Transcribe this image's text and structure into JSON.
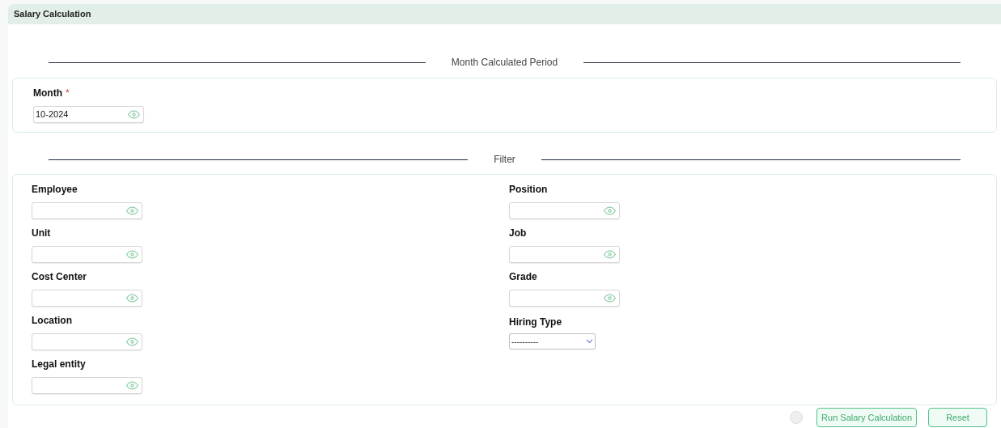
{
  "header": {
    "title": "Salary Calculation"
  },
  "period_section": {
    "title": "Month Calculated Period",
    "fields": [
      {
        "kind": "input",
        "label": "Month",
        "required_marker": "*",
        "value": "10-2024"
      }
    ]
  },
  "filter_section": {
    "title": "Filter",
    "columns": [
      [
        {
          "kind": "input",
          "label": "Employee"
        },
        {
          "kind": "input",
          "label": "Unit"
        },
        {
          "kind": "input",
          "label": "Cost Center"
        },
        {
          "kind": "input",
          "label": "Location"
        },
        {
          "kind": "input",
          "label": "Legal entity"
        }
      ],
      [
        {
          "kind": "input",
          "label": "Position"
        },
        {
          "kind": "input",
          "label": "Job"
        },
        {
          "kind": "input",
          "label": "Grade"
        },
        {
          "kind": "select",
          "label": "Hiring Type",
          "value": "----------"
        }
      ]
    ]
  },
  "buttons": [
    "Run Salary Calculation",
    "Reset"
  ]
}
